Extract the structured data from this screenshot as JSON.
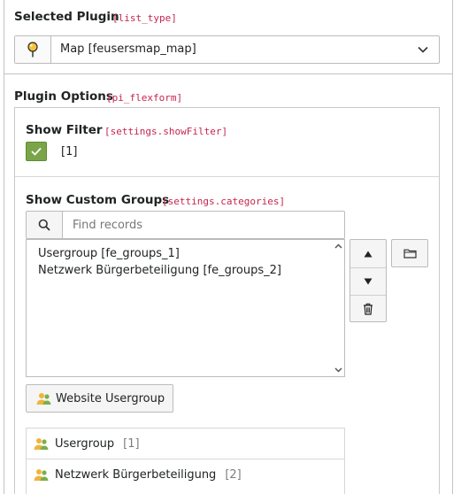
{
  "selected_plugin": {
    "label": "Selected Plugin",
    "field": "[list_type]",
    "value": "Map [feusersmap_map]",
    "icon": "map-marker-icon"
  },
  "plugin_options": {
    "label": "Plugin Options",
    "field": "[pi_flexform]"
  },
  "show_filter": {
    "label": "Show Filter",
    "field": "[settings.showFilter]",
    "checked": true,
    "value": "[1]"
  },
  "custom_groups": {
    "label": "Show Custom Groups",
    "field": "[settings.categories]",
    "search_placeholder": "Find records",
    "search_value": "",
    "records": [
      "Usergroup [fe_groups_1]",
      "Netzwerk Bürgerbeteiligung [fe_groups_2]"
    ],
    "add_button_label": "Website Usergroup",
    "items": [
      {
        "name": "Usergroup",
        "uid": "[1]"
      },
      {
        "name": "Netzwerk Bürgerbeteiligung",
        "uid": "[2]"
      }
    ]
  },
  "colors": {
    "accent_green": "#79a548",
    "field_name": "#c7254e"
  }
}
